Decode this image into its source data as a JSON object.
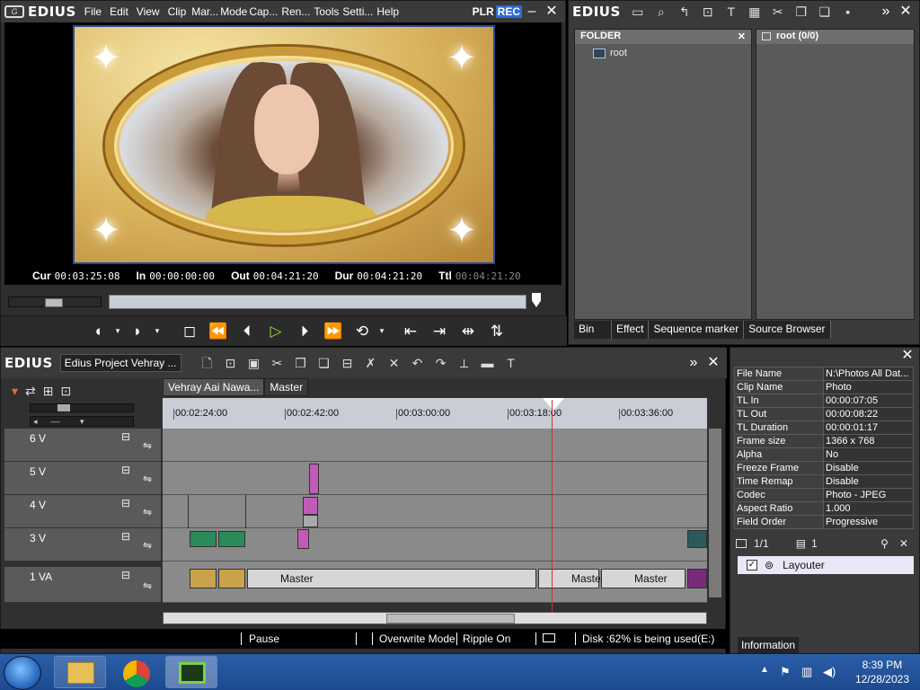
{
  "player": {
    "brand": "EDIUS",
    "menu": [
      "File",
      "Edit",
      "View",
      "Clip",
      "Mar...",
      "Mode",
      "Cap...",
      "Ren...",
      "Tools",
      "Setti...",
      "Help"
    ],
    "plr": "PLR",
    "rec": "REC",
    "timecodes": {
      "cur_label": "Cur",
      "cur": "00:03:25:08",
      "in_label": "In",
      "in": "00:00:00:00",
      "out_label": "Out",
      "out": "00:04:21:20",
      "dur_label": "Dur",
      "dur": "00:04:21:20",
      "ttl_label": "Ttl",
      "ttl": "00:04:21:20"
    }
  },
  "bin": {
    "brand": "EDIUS",
    "folder_header": "FOLDER",
    "root_label": "root",
    "list_header": "root (0/0)",
    "tabs": [
      "Bin",
      "Effect",
      "Sequence marker",
      "Source Browser"
    ]
  },
  "timeline": {
    "brand": "EDIUS",
    "project": "Edius Project Vehray ...",
    "seq_tabs": [
      "Vehray Aai Nawa...",
      "Master"
    ],
    "ruler": [
      "00:02:24:00",
      "00:02:42:00",
      "00:03:00:00",
      "00:03:18:00",
      "00:03:36:00"
    ],
    "tracks": [
      "6 V",
      "5 V",
      "4 V",
      "3 V",
      "1 VA"
    ],
    "master_label": "Master"
  },
  "info": {
    "rows": [
      {
        "k": "File Name",
        "v": "N:\\Photos All Dat..."
      },
      {
        "k": "Clip Name",
        "v": "Photo"
      },
      {
        "k": "TL In",
        "v": "00:00:07:05"
      },
      {
        "k": "TL Out",
        "v": "00:00:08:22"
      },
      {
        "k": "TL Duration",
        "v": "00:00:01:17"
      },
      {
        "k": "Frame size",
        "v": "1366 x 768"
      },
      {
        "k": "Alpha",
        "v": "No"
      },
      {
        "k": "Freeze Frame",
        "v": "Disable"
      },
      {
        "k": "Time Remap",
        "v": "Disable"
      },
      {
        "k": "Codec",
        "v": "Photo - JPEG"
      },
      {
        "k": "Aspect Ratio",
        "v": "1.000"
      },
      {
        "k": "Field Order",
        "v": "Progressive"
      }
    ],
    "page": "1/1",
    "layer_count": "1",
    "layouter": "Layouter",
    "tab": "Information"
  },
  "status": {
    "pause": "Pause",
    "overwrite": "Overwrite Mode",
    "ripple": "Ripple On",
    "disk": "Disk :62% is being used(E:)"
  },
  "taskbar": {
    "time": "8:39 PM",
    "date": "12/28/2023"
  }
}
